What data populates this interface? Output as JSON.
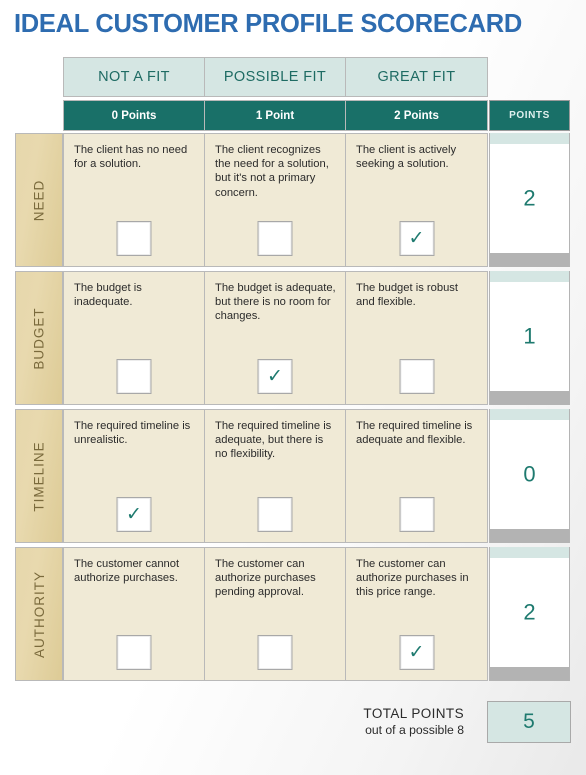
{
  "title": "IDEAL CUSTOMER PROFILE SCORECARD",
  "colors": {
    "title_blue": "#2e6cb0",
    "header_teal_light": "#d5e6e3",
    "header_teal_dark": "#197068",
    "cell_cream": "#f0ead6",
    "label_tan": "#e6d7ac",
    "tick_green": "#1e7a6f"
  },
  "header": {
    "fit_columns": [
      "NOT A FIT",
      "POSSIBLE FIT",
      "GREAT FIT"
    ],
    "point_columns": [
      "0 Points",
      "1 Point",
      "2 Points"
    ],
    "points_column_label": "POINTS"
  },
  "rows": [
    {
      "label": "NEED",
      "cells": [
        {
          "text": "The client has no need for a solution.",
          "checked": false
        },
        {
          "text": "The client recognizes the need for a solution, but it's not a primary concern.",
          "checked": false
        },
        {
          "text": "The client is actively seeking a solution.",
          "checked": true
        }
      ],
      "points": "2"
    },
    {
      "label": "BUDGET",
      "cells": [
        {
          "text": "The budget is inadequate.",
          "checked": false
        },
        {
          "text": "The budget is adequate, but there is no room for changes.",
          "checked": true
        },
        {
          "text": "The budget is robust and flexible.",
          "checked": false
        }
      ],
      "points": "1"
    },
    {
      "label": "TIMELINE",
      "cells": [
        {
          "text": "The required timeline is unrealistic.",
          "checked": true
        },
        {
          "text": "The required timeline is adequate, but there is no flexibility.",
          "checked": false
        },
        {
          "text": "The required timeline is adequate and flexible.",
          "checked": false
        }
      ],
      "points": "0"
    },
    {
      "label": "AUTHORITY",
      "cells": [
        {
          "text": "The customer cannot authorize purchases.",
          "checked": false
        },
        {
          "text": "The customer can authorize purchases pending approval.",
          "checked": false
        },
        {
          "text": "The customer can authorize purchases in this price range.",
          "checked": true
        }
      ],
      "points": "2"
    }
  ],
  "footer": {
    "total_label": "TOTAL POINTS",
    "possible_label": "out of a possible 8",
    "total_value": "5"
  },
  "icons": {
    "check": "✓"
  }
}
